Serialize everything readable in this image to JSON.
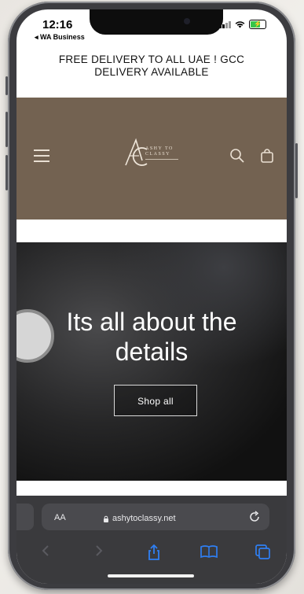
{
  "status_bar": {
    "time": "12:16",
    "back_label": "◂ WA Business"
  },
  "announcement": {
    "line1": "FREE DELIVERY TO ALL UAE ! GCC",
    "line2": "DELIVERY AVAILABLE"
  },
  "header": {
    "logo_line1": "ASHY TO",
    "logo_line2": "CLASSY",
    "background_color": "#736251"
  },
  "hero": {
    "title_line1": "Its all about the",
    "title_line2": "details",
    "cta_label": "Shop all"
  },
  "browser": {
    "text_size_label": "AA",
    "url": "ashytoclassy.net"
  },
  "icons": {
    "menu": "hamburger-icon",
    "search": "search-icon",
    "cart": "cart-icon",
    "reload": "reload-icon",
    "share": "share-icon",
    "bookmarks": "book-icon",
    "tabs": "tabs-icon"
  }
}
